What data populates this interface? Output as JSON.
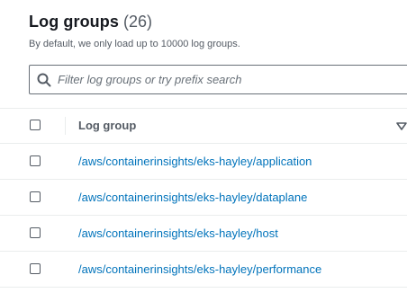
{
  "header": {
    "title": "Log groups",
    "count": "(26)",
    "description": "By default, we only load up to 10000 log groups."
  },
  "search": {
    "placeholder": "Filter log groups or try prefix search",
    "icon": "search-icon"
  },
  "table": {
    "column_header": "Log group",
    "sort_icon": "sort-down-icon",
    "rows": [
      {
        "name": "/aws/containerinsights/eks-hayley/application",
        "checked": false
      },
      {
        "name": "/aws/containerinsights/eks-hayley/dataplane",
        "checked": false
      },
      {
        "name": "/aws/containerinsights/eks-hayley/host",
        "checked": false
      },
      {
        "name": "/aws/containerinsights/eks-hayley/performance",
        "checked": false
      }
    ]
  },
  "colors": {
    "link": "#0073bb",
    "title": "#16191f",
    "secondary_text": "#545b64",
    "border": "#eaeded"
  }
}
